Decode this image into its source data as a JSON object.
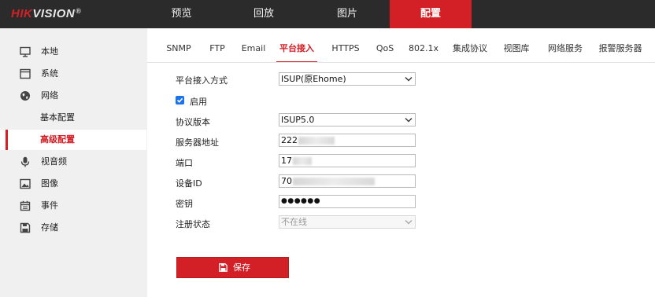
{
  "brand": {
    "name_prefix": "HIK",
    "name_suffix": "VISION",
    "reg_mark": "®"
  },
  "top_nav": [
    {
      "label": "预览"
    },
    {
      "label": "回放"
    },
    {
      "label": "图片"
    },
    {
      "label": "配置",
      "active": true
    }
  ],
  "sidebar": {
    "items": [
      {
        "label": "本地",
        "icon": "monitor-icon"
      },
      {
        "label": "系统",
        "icon": "window-icon"
      },
      {
        "label": "网络",
        "icon": "globe-icon"
      },
      {
        "label": "基本配置",
        "sub": true
      },
      {
        "label": "高级配置",
        "sub": true,
        "active": true
      },
      {
        "label": "视音频",
        "icon": "microphone-icon"
      },
      {
        "label": "图像",
        "icon": "image-icon"
      },
      {
        "label": "事件",
        "icon": "calendar-icon"
      },
      {
        "label": "存储",
        "icon": "floppy-icon"
      }
    ]
  },
  "tabs": [
    {
      "label": "SNMP"
    },
    {
      "label": "FTP"
    },
    {
      "label": "Email"
    },
    {
      "label": "平台接入",
      "active": true
    },
    {
      "label": "HTTPS"
    },
    {
      "label": "QoS"
    },
    {
      "label": "802.1x"
    },
    {
      "label": "集成协议"
    },
    {
      "label": "视图库"
    },
    {
      "label": "网络服务"
    },
    {
      "label": "报警服务器"
    }
  ],
  "form": {
    "access_mode_label": "平台接入方式",
    "access_mode_value": "ISUP(原Ehome)",
    "enable_label": "启用",
    "enable_checked": true,
    "protocol_version_label": "协议版本",
    "protocol_version_value": "ISUP5.0",
    "server_address_label": "服务器地址",
    "server_address_value": "222",
    "port_label": "端口",
    "port_value": "17",
    "device_id_label": "设备ID",
    "device_id_value": "70",
    "key_label": "密钥",
    "key_value": "●●●●●●",
    "register_status_label": "注册状态",
    "register_status_value": "不在线"
  },
  "save_button": {
    "label": "保存"
  },
  "colors": {
    "accent": "#d32027",
    "topbar": "#2b2b2b",
    "checkbox": "#1a73e8"
  }
}
